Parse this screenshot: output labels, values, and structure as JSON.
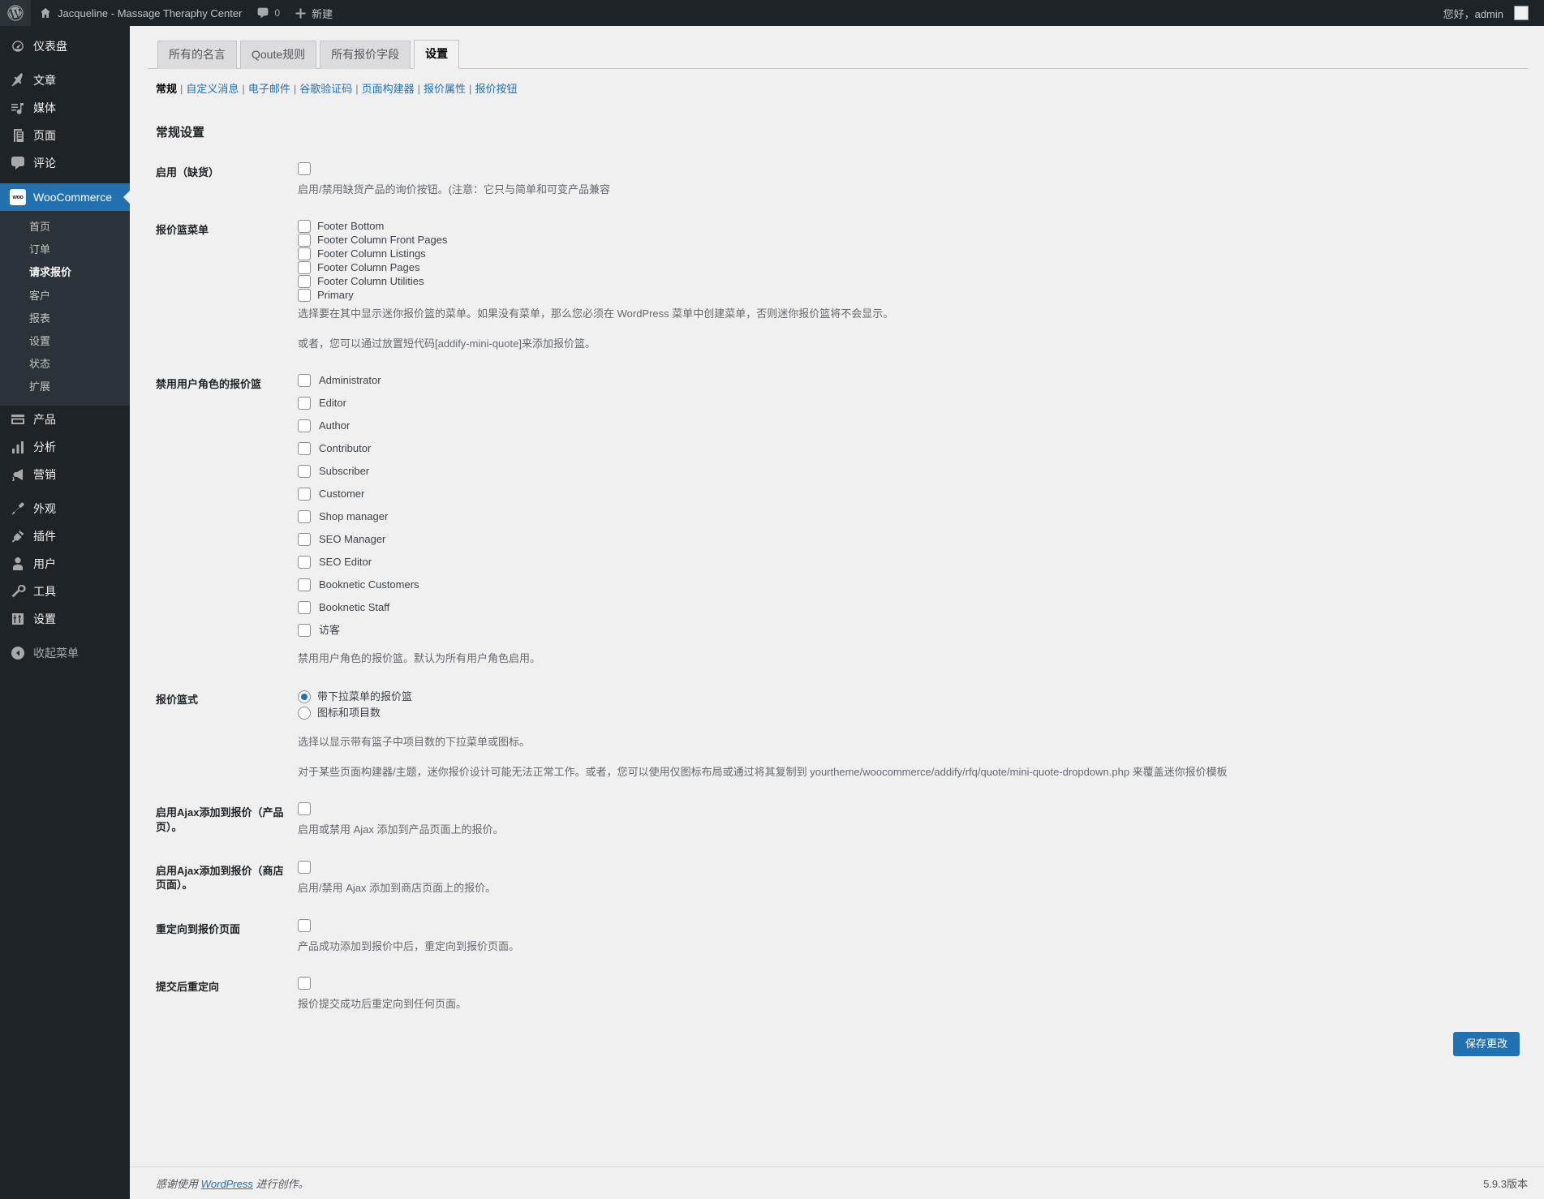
{
  "adminbar": {
    "site_name": "Jacqueline - Massage Theraphy Center",
    "comment_count": "0",
    "new_label": "新建",
    "howdy": "您好，admin"
  },
  "sidebar": {
    "items": [
      {
        "label": "仪表盘",
        "icon": "dashboard-icon"
      },
      {
        "label": "文章",
        "icon": "pin-icon"
      },
      {
        "label": "媒体",
        "icon": "media-icon"
      },
      {
        "label": "页面",
        "icon": "page-icon"
      },
      {
        "label": "评论",
        "icon": "comment-icon"
      },
      {
        "label": "WooCommerce",
        "icon": "woo-icon"
      },
      {
        "label": "产品",
        "icon": "product-icon"
      },
      {
        "label": "分析",
        "icon": "analytics-icon"
      },
      {
        "label": "营销",
        "icon": "megaphone-icon"
      },
      {
        "label": "外观",
        "icon": "appearance-icon"
      },
      {
        "label": "插件",
        "icon": "plugin-icon"
      },
      {
        "label": "用户",
        "icon": "users-icon"
      },
      {
        "label": "工具",
        "icon": "tools-icon"
      },
      {
        "label": "设置",
        "icon": "settings-icon"
      },
      {
        "label": "收起菜单",
        "icon": "collapse-icon"
      }
    ],
    "woocommerce_submenu": [
      {
        "label": "首页"
      },
      {
        "label": "订单"
      },
      {
        "label": "请求报价"
      },
      {
        "label": "客户"
      },
      {
        "label": "报表"
      },
      {
        "label": "设置"
      },
      {
        "label": "状态"
      },
      {
        "label": "扩展"
      }
    ]
  },
  "tabs": [
    {
      "label": "所有的名言"
    },
    {
      "label": "Qoute规则"
    },
    {
      "label": "所有报价字段"
    },
    {
      "label": "设置"
    }
  ],
  "subnav": [
    {
      "label": "常规",
      "current": true
    },
    {
      "label": "自定义消息",
      "current": false
    },
    {
      "label": "电子邮件",
      "current": false
    },
    {
      "label": "谷歌验证码",
      "current": false
    },
    {
      "label": "页面构建器",
      "current": false
    },
    {
      "label": "报价属性",
      "current": false
    },
    {
      "label": "报价按钮",
      "current": false
    }
  ],
  "page": {
    "section_title": "常规设置"
  },
  "rows": {
    "enable_outofstock": {
      "label": "启用（缺货）",
      "description": "启用/禁用缺货产品的询价按钮。(注意：它只与简单和可变产品兼容"
    },
    "quote_basket_menu": {
      "label": "报价篮菜单",
      "options": [
        "Footer Bottom",
        "Footer Column Front Pages",
        "Footer Column Listings",
        "Footer Column Pages",
        "Footer Column Utilities",
        "Primary"
      ],
      "description1": "选择要在其中显示迷你报价篮的菜单。如果没有菜单，那么您必须在 WordPress 菜单中创建菜单，否则迷你报价篮将不会显示。",
      "description2": "或者，您可以通过放置短代码[addify-mini-quote]来添加报价篮。"
    },
    "disable_roles": {
      "label": "禁用用户角色的报价篮",
      "options": [
        "Administrator",
        "Editor",
        "Author",
        "Contributor",
        "Subscriber",
        "Customer",
        "Shop manager",
        "SEO Manager",
        "SEO Editor",
        "Booknetic Customers",
        "Booknetic Staff",
        "访客"
      ],
      "description": "禁用用户角色的报价篮。默认为所有用户角色启用。"
    },
    "basket_style": {
      "label": "报价篮式",
      "options": [
        {
          "label": "带下拉菜单的报价篮",
          "selected": true
        },
        {
          "label": "图标和项目数",
          "selected": false
        }
      ],
      "description1": "选择以显示带有篮子中项目数的下拉菜单或图标。",
      "description2": "对于某些页面构建器/主题，迷你报价设计可能无法正常工作。或者，您可以使用仅图标布局或通过将其复制到 yourtheme/woocommerce/addify/rfq/quote/mini-quote-dropdown.php 来覆盖迷你报价模板"
    },
    "ajax_product_page": {
      "label": "启用Ajax添加到报价（产品页）。",
      "description": "启用或禁用 Ajax 添加到产品页面上的报价。"
    },
    "ajax_shop_page": {
      "label": "启用Ajax添加到报价（商店页面）。",
      "description": "启用/禁用 Ajax 添加到商店页面上的报价。"
    },
    "redirect_quote_page": {
      "label": "重定向到报价页面",
      "description": "产品成功添加到报价中后，重定向到报价页面。"
    },
    "redirect_after_submit": {
      "label": "提交后重定向",
      "description": "报价提交成功后重定向到任何页面。"
    }
  },
  "submit": {
    "label": "保存更改"
  },
  "footer": {
    "thanks_prefix": "感谢使用 ",
    "thanks_link": "WordPress",
    "thanks_suffix": " 进行创作。",
    "version": "5.9.3版本"
  },
  "colors": {
    "accent": "#2271b1",
    "sidebar_bg": "#1d2327",
    "submenu_bg": "#2c3338",
    "page_bg": "#f0f0f1"
  }
}
